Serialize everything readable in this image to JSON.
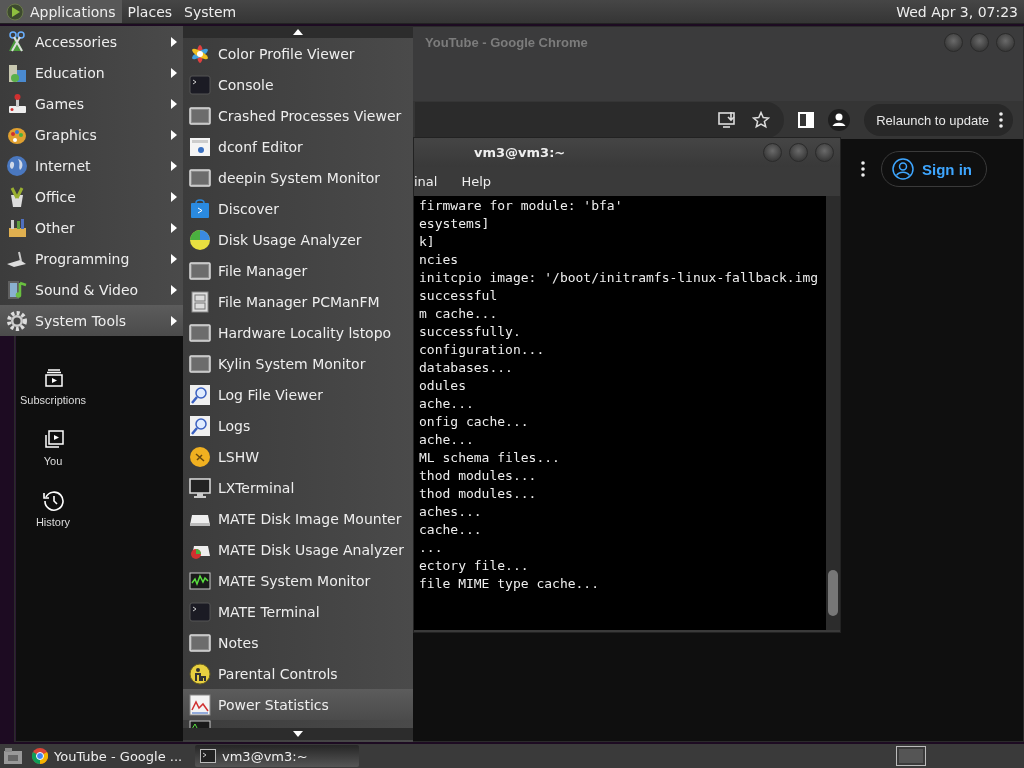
{
  "top_panel": {
    "menus": [
      {
        "label": "Applications",
        "selected": true
      },
      {
        "label": "Places",
        "selected": false
      },
      {
        "label": "System",
        "selected": false
      }
    ],
    "clock": "Wed Apr  3, 07:23"
  },
  "chrome_window": {
    "title": "YouTube - Google Chrome",
    "relaunch_button": "Relaunch to update",
    "sign_in": "Sign in",
    "sidebar": [
      {
        "label": "Subscriptions",
        "kind": "subscriptions"
      },
      {
        "label": "You",
        "kind": "library"
      },
      {
        "label": "History",
        "kind": "history"
      }
    ]
  },
  "terminal_window": {
    "title": "vm3@vm3:~",
    "menus": [
      "inal",
      "Help"
    ],
    "lines": [
      "firmware for module: 'bfa'",
      "esystems]",
      "k]",
      "ncies",
      "initcpio image: '/boot/initramfs-linux-fallback.img",
      "successful",
      "m cache...",
      "successfully.",
      "configuration...",
      "databases...",
      "odules",
      "ache...",
      "onfig cache...",
      "ache...",
      "ML schema files...",
      "thod modules...",
      "thod modules...",
      "aches...",
      "cache...",
      "...",
      "ectory file...",
      "file MIME type cache..."
    ]
  },
  "applications_menu": {
    "items": [
      {
        "label": "Accessories",
        "kind": "accessories",
        "selected": false
      },
      {
        "label": "Education",
        "kind": "education",
        "selected": false
      },
      {
        "label": "Games",
        "kind": "games",
        "selected": false
      },
      {
        "label": "Graphics",
        "kind": "graphics",
        "selected": false
      },
      {
        "label": "Internet",
        "kind": "globe",
        "selected": false
      },
      {
        "label": "Office",
        "kind": "office",
        "selected": false
      },
      {
        "label": "Other",
        "kind": "other",
        "selected": false
      },
      {
        "label": "Programming",
        "kind": "programming",
        "selected": false
      },
      {
        "label": "Sound & Video",
        "kind": "media",
        "selected": false
      },
      {
        "label": "System Tools",
        "kind": "gear",
        "selected": true
      }
    ]
  },
  "system_tools_menu": {
    "items": [
      {
        "label": "Color Profile Viewer",
        "kind": "flower",
        "selected": false
      },
      {
        "label": "Console",
        "kind": "terminal",
        "selected": false
      },
      {
        "label": "Crashed Processes Viewer",
        "kind": "window",
        "selected": false
      },
      {
        "label": "dconf Editor",
        "kind": "dconf",
        "selected": false
      },
      {
        "label": "deepin System Monitor",
        "kind": "window",
        "selected": false
      },
      {
        "label": "Discover",
        "kind": "store",
        "selected": false
      },
      {
        "label": "Disk Usage Analyzer",
        "kind": "pie",
        "selected": false
      },
      {
        "label": "File Manager",
        "kind": "window",
        "selected": false
      },
      {
        "label": "File Manager PCManFM",
        "kind": "cabinet",
        "selected": false
      },
      {
        "label": "Hardware Locality lstopo",
        "kind": "window",
        "selected": false
      },
      {
        "label": "Kylin System Monitor",
        "kind": "window",
        "selected": false
      },
      {
        "label": "Log File Viewer",
        "kind": "magnifier",
        "selected": false
      },
      {
        "label": "Logs",
        "kind": "magnifier",
        "selected": false
      },
      {
        "label": "LSHW",
        "kind": "badge",
        "selected": false
      },
      {
        "label": "LXTerminal",
        "kind": "monitor",
        "selected": false
      },
      {
        "label": "MATE Disk Image Mounter",
        "kind": "drive",
        "selected": false
      },
      {
        "label": "MATE Disk Usage Analyzer",
        "kind": "disk",
        "selected": false
      },
      {
        "label": "MATE System Monitor",
        "kind": "graph",
        "selected": false
      },
      {
        "label": "MATE Terminal",
        "kind": "terminal",
        "selected": false
      },
      {
        "label": "Notes",
        "kind": "window",
        "selected": false
      },
      {
        "label": "Parental Controls",
        "kind": "person",
        "selected": false
      },
      {
        "label": "Power Statistics",
        "kind": "chart",
        "selected": true
      }
    ]
  },
  "taskbar": {
    "tasks": [
      {
        "label": "YouTube - Google ...",
        "kind": "browser",
        "selected": false
      },
      {
        "label": "vm3@vm3:~",
        "kind": "terminal",
        "selected": true
      }
    ]
  }
}
